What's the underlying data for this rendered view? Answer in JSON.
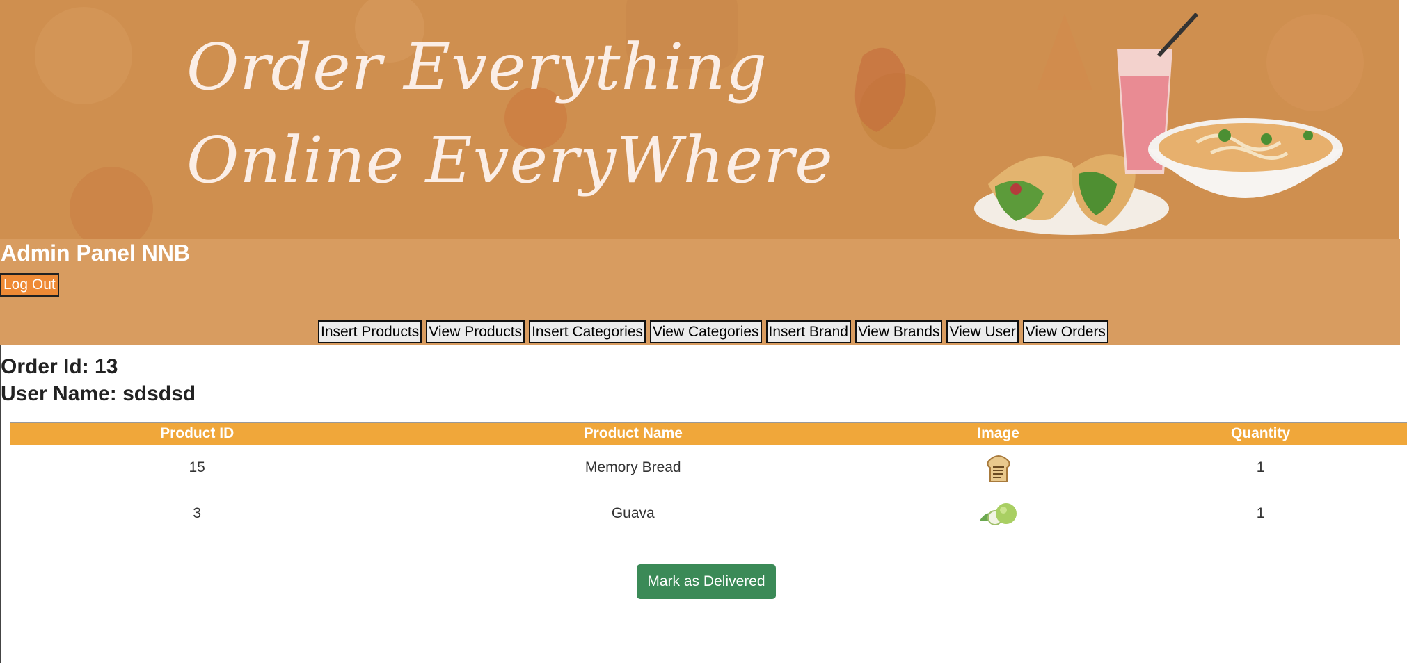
{
  "banner": {
    "tagline_line1": "Order Everything",
    "tagline_line2": "Online EveryWhere"
  },
  "header": {
    "title": "Admin Panel NNB",
    "logout_label": "Log Out"
  },
  "nav": {
    "items": [
      "Insert Products",
      "View Products",
      "Insert Categories",
      "View Categories",
      "Insert Brand",
      "View Brands",
      "View User",
      "View Orders"
    ]
  },
  "order": {
    "id_label": "Order Id:",
    "id_value": "13",
    "user_label": "User Name:",
    "user_value": "sdsdsd"
  },
  "table": {
    "headers": [
      "Product ID",
      "Product Name",
      "Image",
      "Quantity"
    ],
    "rows": [
      {
        "product_id": "15",
        "product_name": "Memory Bread",
        "image_icon": "bread-icon",
        "quantity": "1"
      },
      {
        "product_id": "3",
        "product_name": "Guava",
        "image_icon": "guava-icon",
        "quantity": "1"
      }
    ]
  },
  "actions": {
    "deliver_label": "Mark as Delivered"
  },
  "colors": {
    "banner_bg": "#cf8f4f",
    "header_bg": "#d89c60",
    "logout_bg": "#ee8a35",
    "table_header_bg": "#f0a73a",
    "deliver_bg": "#3b8a57"
  }
}
